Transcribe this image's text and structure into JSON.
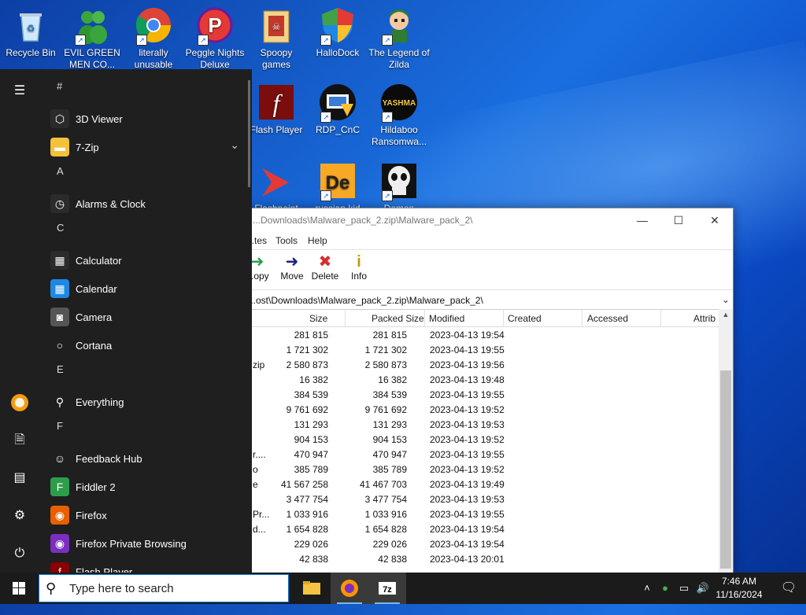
{
  "desktop": {
    "icons": [
      {
        "label": "Recycle Bin",
        "icon": "recycle-bin-icon"
      },
      {
        "label": "EVIL GREEN MEN CO...",
        "icon": "green-men-icon"
      },
      {
        "label": "literally unusable",
        "icon": "chrome-icon"
      },
      {
        "label": "Peggle Nights Deluxe",
        "icon": "peggle-icon"
      },
      {
        "label": "Spoopy games",
        "icon": "folder-icon"
      },
      {
        "label": "HalloDock",
        "icon": "shield-icon"
      },
      {
        "label": "The Legend of Zilda",
        "icon": "zilda-icon"
      },
      {
        "label": "Flash Player",
        "icon": "flash-icon"
      },
      {
        "label": "RDP_CnC",
        "icon": "rdp-icon"
      },
      {
        "label": "Hildaboo Ransomwa...",
        "icon": "yashma-icon"
      },
      {
        "label": "Flashpoint",
        "icon": "flashpoint-icon"
      },
      {
        "label": "russian kid",
        "icon": "de-icon"
      },
      {
        "label": "Demon",
        "icon": "punisher-icon"
      }
    ]
  },
  "window": {
    "title": "...Downloads\\Malware_pack_2.zip\\Malware_pack_2\\",
    "menu": [
      "...tes",
      "Tools",
      "Help"
    ],
    "toolbar": [
      {
        "label": "...opy",
        "icon": "copy-icon"
      },
      {
        "label": "Move",
        "icon": "move-icon"
      },
      {
        "label": "Delete",
        "icon": "delete-icon"
      },
      {
        "label": "Info",
        "icon": "info-icon"
      }
    ],
    "address": "...ost\\Downloads\\Malware_pack_2.zip\\Malware_pack_2\\",
    "columns": [
      "Size",
      "Packed Size",
      "Modified",
      "Created",
      "Accessed",
      "Attrib"
    ],
    "rows": [
      {
        "name": "",
        "size": "281 815",
        "packed": "281 815",
        "modified": "2023-04-13 19:54"
      },
      {
        "name": "",
        "size": "1 721 302",
        "packed": "1 721 302",
        "modified": "2023-04-13 19:55"
      },
      {
        "name": "zip",
        "size": "2 580 873",
        "packed": "2 580 873",
        "modified": "2023-04-13 19:56"
      },
      {
        "name": "",
        "size": "16 382",
        "packed": "16 382",
        "modified": "2023-04-13 19:48"
      },
      {
        "name": "",
        "size": "384 539",
        "packed": "384 539",
        "modified": "2023-04-13 19:55"
      },
      {
        "name": "",
        "size": "9 761 692",
        "packed": "9 761 692",
        "modified": "2023-04-13 19:52"
      },
      {
        "name": "",
        "size": "131 293",
        "packed": "131 293",
        "modified": "2023-04-13 19:53"
      },
      {
        "name": "",
        "size": "904 153",
        "packed": "904 153",
        "modified": "2023-04-13 19:52"
      },
      {
        "name": "r....",
        "size": "470 947",
        "packed": "470 947",
        "modified": "2023-04-13 19:55"
      },
      {
        "name": "o",
        "size": "385 789",
        "packed": "385 789",
        "modified": "2023-04-13 19:52"
      },
      {
        "name": "e",
        "size": "41 567 258",
        "packed": "41 467 703",
        "modified": "2023-04-13 19:49"
      },
      {
        "name": "",
        "size": "3 477 754",
        "packed": "3 477 754",
        "modified": "2023-04-13 19:53"
      },
      {
        "name": "Pr...",
        "size": "1 033 916",
        "packed": "1 033 916",
        "modified": "2023-04-13 19:55"
      },
      {
        "name": "d...",
        "size": "1 654 828",
        "packed": "1 654 828",
        "modified": "2023-04-13 19:54"
      },
      {
        "name": "",
        "size": "229 026",
        "packed": "229 026",
        "modified": "2023-04-13 19:54"
      },
      {
        "name": "",
        "size": "42 838",
        "packed": "42 838",
        "modified": "2023-04-13 20:01"
      }
    ]
  },
  "start_menu": {
    "items": [
      {
        "kind": "header",
        "text": "#"
      },
      {
        "kind": "app",
        "text": "3D Viewer",
        "icon": "cube-icon",
        "color": "#2b2b2b"
      },
      {
        "kind": "app",
        "text": "7-Zip",
        "icon": "folder-icon",
        "color": "#f3c13a",
        "expand": "⌄"
      },
      {
        "kind": "header",
        "text": "A"
      },
      {
        "kind": "app",
        "text": "Alarms & Clock",
        "icon": "clock-icon",
        "color": "#2b2b2b"
      },
      {
        "kind": "header",
        "text": "C"
      },
      {
        "kind": "app",
        "text": "Calculator",
        "icon": "calculator-icon",
        "color": "#2b2b2b"
      },
      {
        "kind": "app",
        "text": "Calendar",
        "icon": "calendar-icon",
        "color": "#1e88e5"
      },
      {
        "kind": "app",
        "text": "Camera",
        "icon": "camera-icon",
        "color": "#555"
      },
      {
        "kind": "app",
        "text": "Cortana",
        "icon": "cortana-icon",
        "color": "#1f1f1f"
      },
      {
        "kind": "header",
        "text": "E"
      },
      {
        "kind": "app",
        "text": "Everything",
        "icon": "search-magnifier-icon",
        "color": "#1f1f1f"
      },
      {
        "kind": "header",
        "text": "F"
      },
      {
        "kind": "app",
        "text": "Feedback Hub",
        "icon": "feedback-icon",
        "color": "#1f1f1f"
      },
      {
        "kind": "app",
        "text": "Fiddler 2",
        "icon": "fiddler-icon",
        "color": "#2e9d4a"
      },
      {
        "kind": "app",
        "text": "Firefox",
        "icon": "firefox-icon",
        "color": "#e66000"
      },
      {
        "kind": "app",
        "text": "Firefox Private Browsing",
        "icon": "firefox-private-icon",
        "color": "#7b2fbf"
      },
      {
        "kind": "app",
        "text": "Flash Player",
        "icon": "flash-icon",
        "color": "#8b0000"
      }
    ]
  },
  "taskbar": {
    "search_placeholder": "Type here to search",
    "time": "7:46 AM",
    "date": "11/16/2024"
  }
}
